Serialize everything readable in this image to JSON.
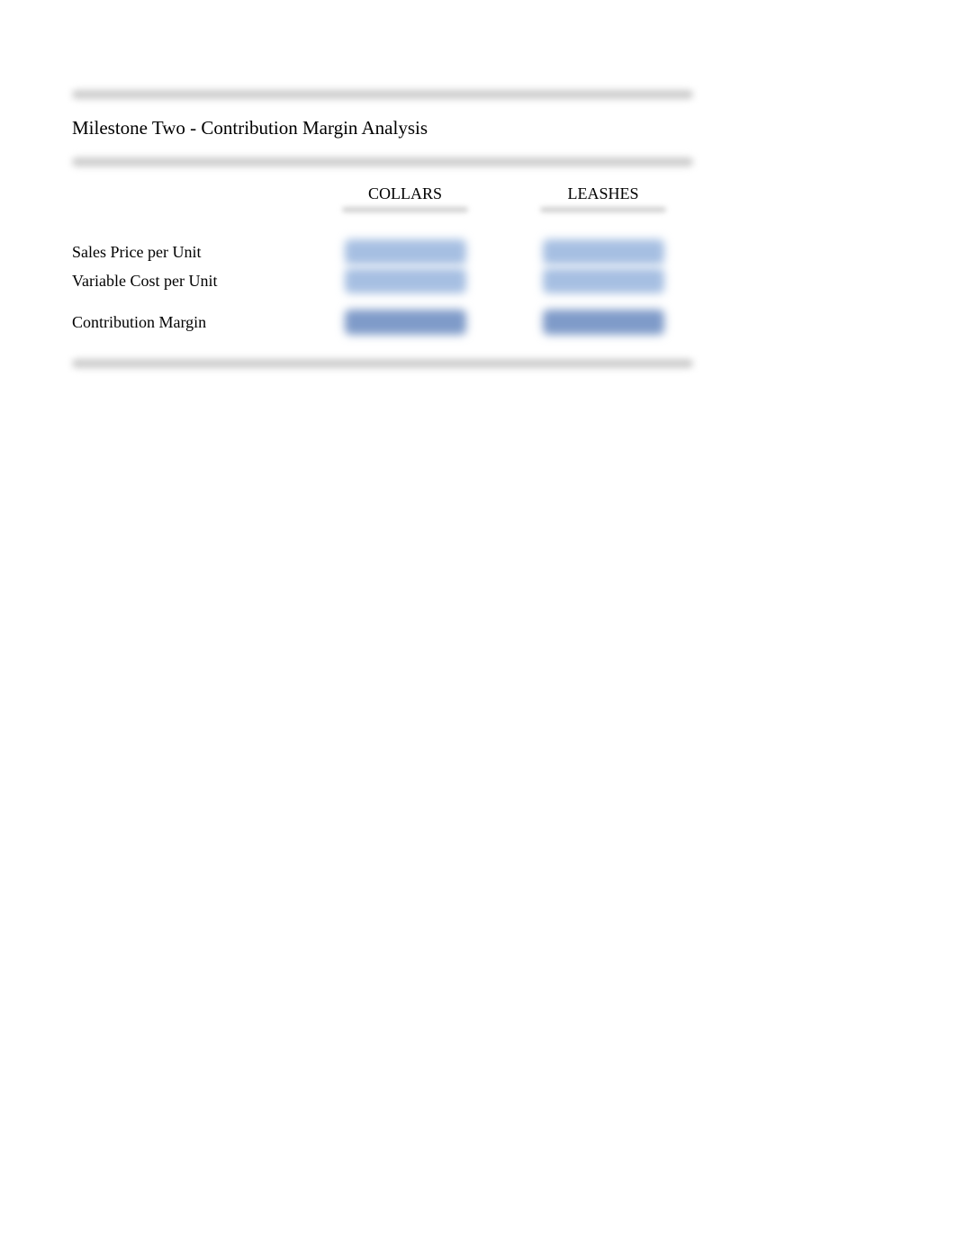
{
  "title": "Milestone Two - Contribution Margin Analysis",
  "columns": {
    "col1": "COLLARS",
    "col2": "LEASHES"
  },
  "rows": {
    "sales_price": "Sales Price per Unit",
    "variable_cost": "Variable Cost per Unit",
    "contribution_margin": "Contribution Margin"
  }
}
